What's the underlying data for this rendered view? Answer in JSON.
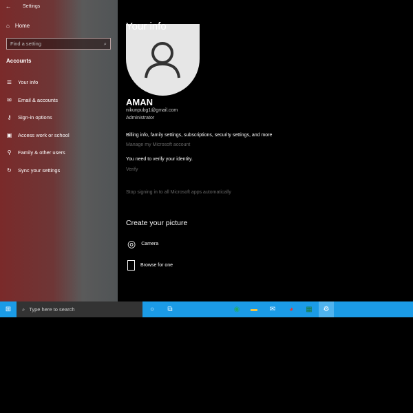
{
  "window": {
    "title": "Settings"
  },
  "sidebar": {
    "home": "Home",
    "search_placeholder": "Find a setting",
    "section": "Accounts",
    "items": [
      {
        "label": "Your info",
        "icon": "person-card-icon"
      },
      {
        "label": "Email & accounts",
        "icon": "mail-icon"
      },
      {
        "label": "Sign-in options",
        "icon": "key-icon"
      },
      {
        "label": "Access work or school",
        "icon": "briefcase-icon"
      },
      {
        "label": "Family & other users",
        "icon": "person-add-icon"
      },
      {
        "label": "Sync your settings",
        "icon": "sync-icon"
      }
    ]
  },
  "main": {
    "title": "Your info",
    "name": "AMAN",
    "email": "nikunpubg1@gmail.com",
    "role": "Administrator",
    "billing_text": "Billing info, family settings, subscriptions, security settings, and more",
    "manage_link": "Manage my Microsoft account",
    "verify_text": "You need to verify your identity.",
    "verify_link": "Verify",
    "stop_link": "Stop signing in to all Microsoft apps automatically",
    "picture_title": "Create your picture",
    "camera": "Camera",
    "browse": "Browse for one"
  },
  "taskbar": {
    "search_placeholder": "Type here to search",
    "accent": "#1b9be6"
  }
}
